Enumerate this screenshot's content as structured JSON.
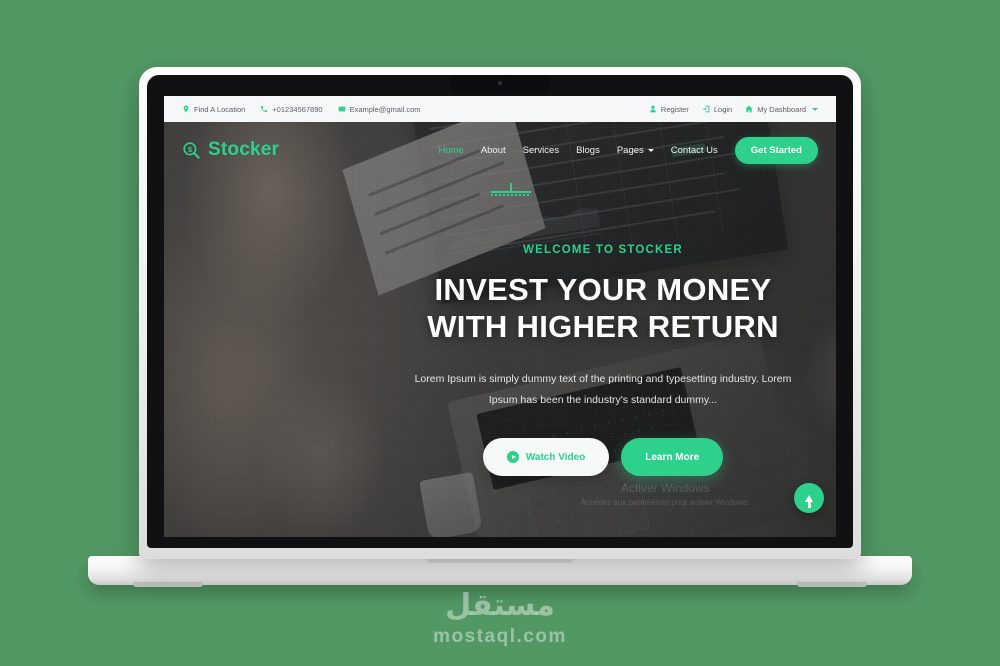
{
  "page": {
    "background_color": "#529865",
    "accent_color": "#2ED18C"
  },
  "device": {
    "name": "laptop-mockup"
  },
  "site": {
    "topbar": {
      "contact": [
        {
          "icon": "map-pin-icon",
          "label": "Find A Location"
        },
        {
          "icon": "phone-icon",
          "label": "+01234567890"
        },
        {
          "icon": "envelope-icon",
          "label": "Example@gmail.com"
        }
      ],
      "account": [
        {
          "icon": "user-icon",
          "label": "Register"
        },
        {
          "icon": "login-icon",
          "label": "Login"
        },
        {
          "icon": "home-icon",
          "label": "My Dashboard",
          "has_chevron": true
        }
      ]
    },
    "brand": {
      "logo_icon": "magnifier-dollar-icon",
      "name": "Stocker"
    },
    "nav": {
      "items": [
        {
          "label": "Home",
          "active": true,
          "has_chevron": false
        },
        {
          "label": "About",
          "active": false,
          "has_chevron": false
        },
        {
          "label": "Services",
          "active": false,
          "has_chevron": false
        },
        {
          "label": "Blogs",
          "active": false,
          "has_chevron": false
        },
        {
          "label": "Pages",
          "active": false,
          "has_chevron": true
        },
        {
          "label": "Contact Us",
          "active": false,
          "has_chevron": false
        }
      ],
      "cta_label": "Get Started"
    },
    "hero": {
      "eyebrow": "WELCOME TO STOCKER",
      "heading_line1": "INVEST YOUR MONEY",
      "heading_line2": "WITH HIGHER RETURN",
      "paragraph_line1": "Lorem Ipsum is simply dummy text of the printing and typesetting",
      "paragraph_line2": "industry. Lorem Ipsum has been the industry's standard dummy...",
      "btn_watch_label": "Watch Video",
      "btn_learn_label": "Learn More"
    },
    "scroll_top": {
      "icon": "arrow-up-icon"
    },
    "windows_watermark": {
      "line1": "Activer Windows",
      "line2": "Accédez aux paramètres pour activer Windows."
    }
  },
  "watermark": {
    "arabic": "مستقل",
    "latin": "mostaql.com"
  }
}
